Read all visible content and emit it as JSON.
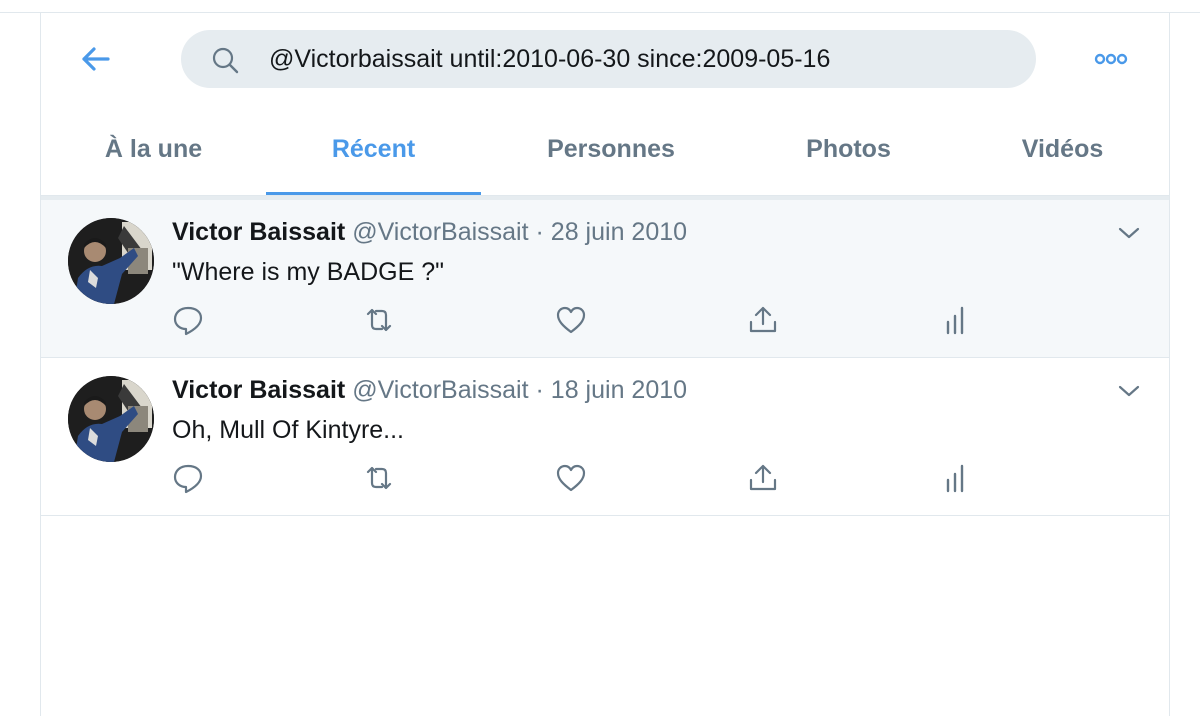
{
  "search": {
    "query": "@Victorbaissait until:2010-06-30 since:2009-05-16"
  },
  "tabs": [
    {
      "label": "À la une"
    },
    {
      "label": "Récent",
      "active": true
    },
    {
      "label": "Personnes"
    },
    {
      "label": "Photos"
    },
    {
      "label": "Vidéos"
    }
  ],
  "tweets": [
    {
      "name": "Victor Baissait",
      "handle": "@VictorBaissait",
      "separator": "·",
      "date": "28 juin 2010",
      "text": "\"Where is my BADGE ?\""
    },
    {
      "name": "Victor Baissait",
      "handle": "@VictorBaissait",
      "separator": "·",
      "date": "18 juin 2010",
      "text": "Oh, Mull Of Kintyre..."
    }
  ],
  "icons": {
    "back": "arrow-left-icon",
    "search": "search-icon",
    "more": "more-icon",
    "caret": "chevron-down-icon",
    "reply": "reply-icon",
    "retweet": "retweet-icon",
    "like": "like-icon",
    "share": "share-icon",
    "analytics": "analytics-icon"
  },
  "colors": {
    "accent": "#4a99e9",
    "muted": "#657786",
    "text": "#14171a",
    "search_bg": "#e6ecf0",
    "highlight_bg": "#f5f8fa",
    "border": "#e1e8ed"
  }
}
